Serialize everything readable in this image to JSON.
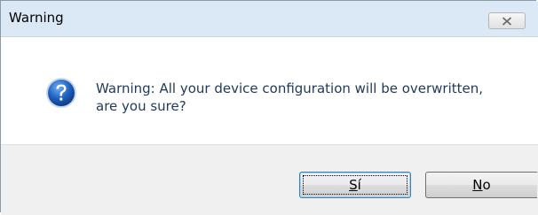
{
  "dialog": {
    "title": "Warning",
    "message_line1": "Warning: All your device configuration will be overwritten,",
    "message_line2": "are you sure?",
    "icon": "question-icon",
    "buttons": {
      "yes": {
        "mnemonic": "S",
        "rest": "í"
      },
      "no": {
        "mnemonic": "N",
        "rest": "o"
      }
    },
    "close_icon": "close-icon"
  },
  "colors": {
    "title_bar": "#dbe9f7",
    "message_text": "#1e395b",
    "footer": "#f0f0f0",
    "icon_blue": "#1f5fbf"
  }
}
